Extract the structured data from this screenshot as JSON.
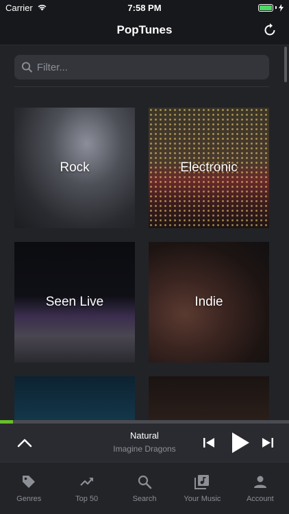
{
  "status_bar": {
    "carrier": "Carrier",
    "time": "7:58 PM"
  },
  "nav": {
    "title": "PopTunes",
    "refresh_icon": "refresh-icon"
  },
  "search": {
    "placeholder": "Filter...",
    "value": ""
  },
  "genres": [
    {
      "label": "Rock"
    },
    {
      "label": "Electronic"
    },
    {
      "label": "Seen Live"
    },
    {
      "label": "Indie"
    }
  ],
  "player": {
    "title": "Natural",
    "artist": "Imagine Dragons",
    "progress": 0.045
  },
  "tabs": [
    {
      "label": "Genres",
      "icon": "tag-icon"
    },
    {
      "label": "Top 50",
      "icon": "trending-icon"
    },
    {
      "label": "Search",
      "icon": "search-icon"
    },
    {
      "label": "Your Music",
      "icon": "music-library-icon"
    },
    {
      "label": "Account",
      "icon": "person-icon"
    }
  ],
  "colors": {
    "accent": "#67bf2a",
    "background": "#1f2024",
    "tab_inactive": "#8d8f96"
  }
}
